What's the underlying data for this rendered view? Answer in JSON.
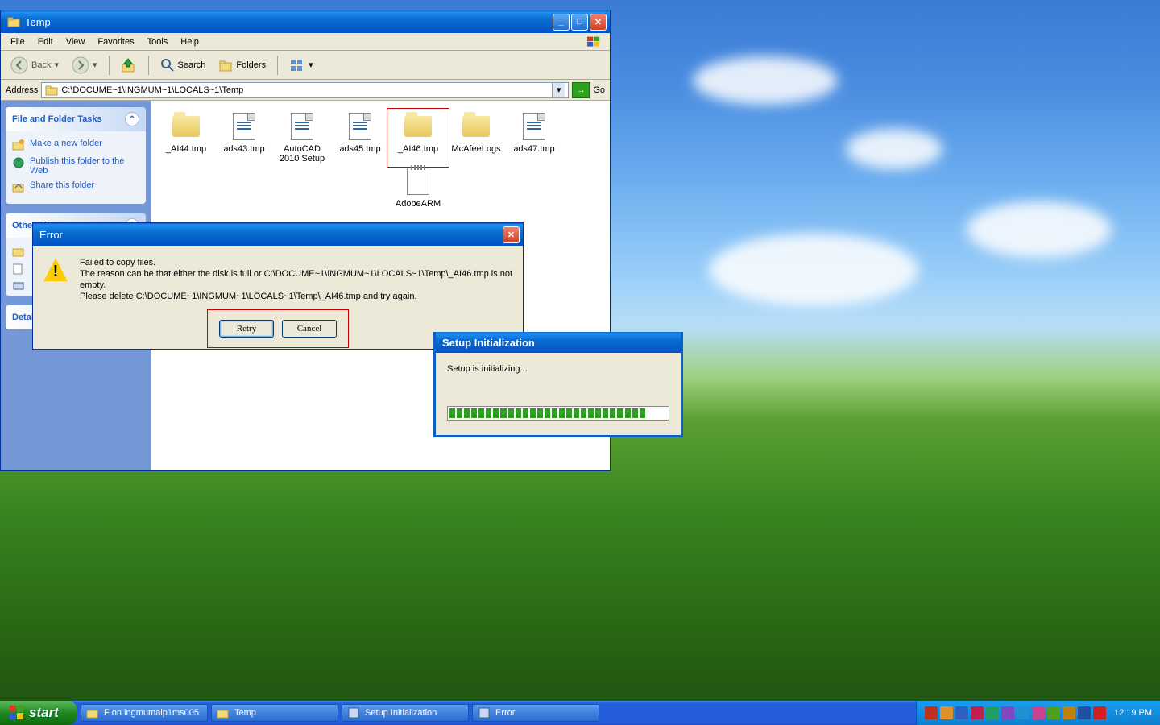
{
  "explorer": {
    "title": "Temp",
    "menu": [
      "File",
      "Edit",
      "View",
      "Favorites",
      "Tools",
      "Help"
    ],
    "toolbar": {
      "back": "Back",
      "search": "Search",
      "folders": "Folders"
    },
    "address_label": "Address",
    "address_path": "C:\\DOCUME~1\\INGMUM~1\\LOCALS~1\\Temp",
    "go_label": "Go",
    "panels": {
      "tasks_header": "File and Folder Tasks",
      "tasks": [
        "Make a new folder",
        "Publish this folder to the Web",
        "Share this folder"
      ],
      "other_header": "Other Places",
      "details_header": "Details"
    },
    "files": [
      {
        "name": "_AI44.tmp",
        "type": "folder"
      },
      {
        "name": "ads43.tmp",
        "type": "file"
      },
      {
        "name": "AutoCAD 2010 Setup",
        "type": "file"
      },
      {
        "name": "ads45.tmp",
        "type": "file"
      },
      {
        "name": "_AI46.tmp",
        "type": "folder",
        "selected": true
      },
      {
        "name": "McAfeeLogs",
        "type": "folder"
      },
      {
        "name": "ads47.tmp",
        "type": "file"
      },
      {
        "name": "AdobeARM",
        "type": "txt"
      }
    ]
  },
  "error_dialog": {
    "title": "Error",
    "line1": "Failed to copy files.",
    "line2": "The reason can be that either the disk is full or C:\\DOCUME~1\\INGMUM~1\\LOCALS~1\\Temp\\_AI46.tmp is not empty.",
    "line3": "Please delete C:\\DOCUME~1\\INGMUM~1\\LOCALS~1\\Temp\\_AI46.tmp and try again.",
    "retry": "Retry",
    "cancel": "Cancel"
  },
  "setup_dialog": {
    "title": "Setup Initialization",
    "message": "Setup is initializing...",
    "progress_filled": 27,
    "progress_total": 30
  },
  "taskbar": {
    "start": "start",
    "buttons": [
      "F on ingmumalp1ms005",
      "Temp",
      "Setup Initialization",
      "Error"
    ],
    "clock": "12:19 PM",
    "tray_icons": [
      "#c03020",
      "#e09028",
      "#3060c0",
      "#c02050",
      "#20a060",
      "#8048c0",
      "#2090d0",
      "#d04090",
      "#50a020",
      "#c08010",
      "#2050a0",
      "#d02020"
    ]
  }
}
